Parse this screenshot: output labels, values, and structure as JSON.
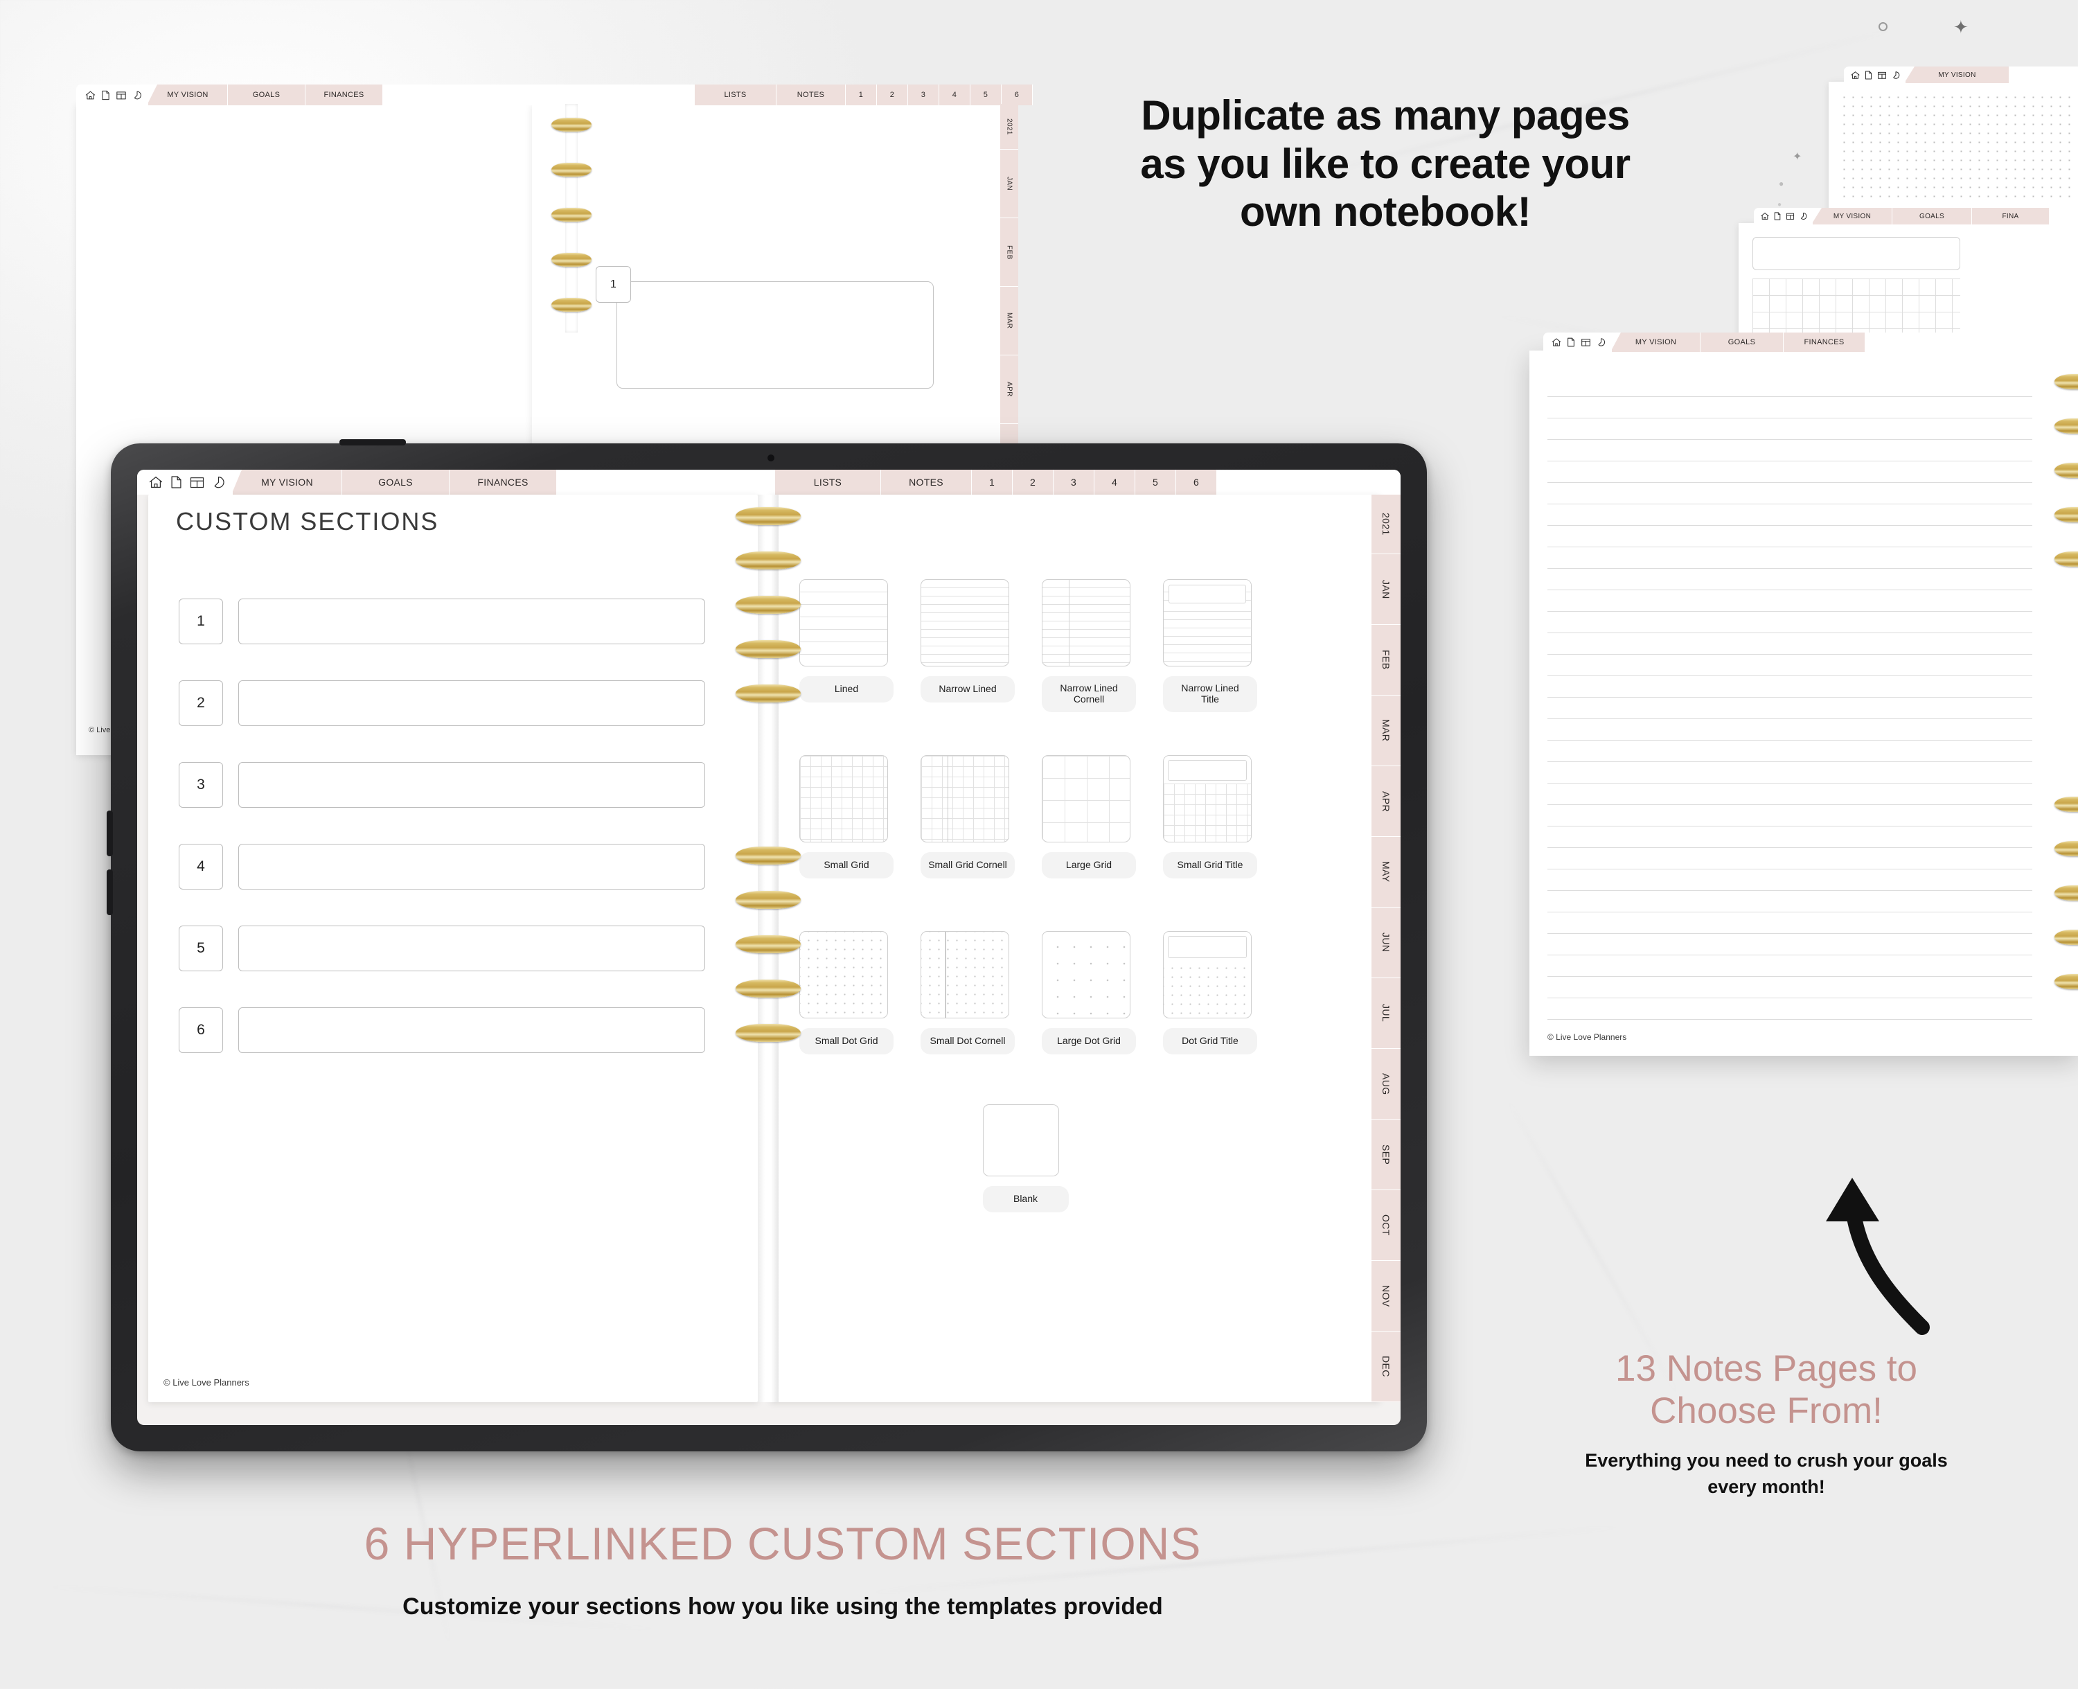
{
  "brand": {
    "accent": "#c4938f",
    "tab_pink": "#eedfdc",
    "copyright": "© Live Love Planners"
  },
  "annotations": {
    "top_right_headline": "Duplicate as many pages\nas you like to create your\nown notebook!",
    "top_right_line1": "Duplicate as many pages",
    "top_right_line2": "as you like to create your",
    "top_right_line3": "own notebook!",
    "bottom_right_headline_line1": "13 Notes Pages to",
    "bottom_right_headline_line2": "Choose From!",
    "bottom_right_sub_line1": "Everything you need to crush your goals",
    "bottom_right_sub_line2": "every month!",
    "bottom_center_headline": "6 HYPERLINKED CUSTOM SECTIONS",
    "bottom_center_sub": "Customize your sections how you like using the templates provided"
  },
  "toolbar": {
    "icons": [
      {
        "name": "home-icon",
        "label": "Home"
      },
      {
        "name": "page-icon",
        "label": "Page"
      },
      {
        "name": "layout-icon",
        "label": "Layout"
      },
      {
        "name": "sticker-icon",
        "label": "Stickers"
      }
    ],
    "left_tabs": [
      "MY VISION",
      "GOALS",
      "FINANCES"
    ],
    "right_tabs": [
      "LISTS",
      "NOTES"
    ],
    "number_tabs": [
      "1",
      "2",
      "3",
      "4",
      "5",
      "6"
    ]
  },
  "month_rail": {
    "year": "2021",
    "months": [
      "JAN",
      "FEB",
      "MAR",
      "APR",
      "MAY",
      "JUN",
      "JUL",
      "AUG",
      "SEP",
      "OCT",
      "NOV",
      "DEC"
    ]
  },
  "page": {
    "title": "CUSTOM SECTIONS",
    "sections": [
      {
        "number": "1",
        "value": ""
      },
      {
        "number": "2",
        "value": ""
      },
      {
        "number": "3",
        "value": ""
      },
      {
        "number": "4",
        "value": ""
      },
      {
        "number": "5",
        "value": ""
      },
      {
        "number": "6",
        "value": ""
      }
    ],
    "templates": [
      {
        "label": "Lined",
        "style": "lined"
      },
      {
        "label": "Narrow Lined",
        "style": "narrow-lined"
      },
      {
        "label": "Narrow Lined\nCornell",
        "style": "narrow-lined-cornell"
      },
      {
        "label": "Narrow Lined\nTitle",
        "style": "narrow-lined-title"
      },
      {
        "label": "Small Grid",
        "style": "small-grid"
      },
      {
        "label": "Small Grid Cornell",
        "style": "small-grid-cornell"
      },
      {
        "label": "Large Grid",
        "style": "large-grid"
      },
      {
        "label": "Small Grid Title",
        "style": "small-grid-title"
      },
      {
        "label": "Small Dot Grid",
        "style": "small-dot"
      },
      {
        "label": "Small Dot Cornell",
        "style": "small-dot-cornell"
      },
      {
        "label": "Large Dot Grid",
        "style": "large-dot"
      },
      {
        "label": "Dot Grid Title",
        "style": "dot-title"
      },
      {
        "label": "Blank",
        "style": "blank"
      }
    ]
  },
  "background_planners": {
    "top_left": {
      "left_tabs": [
        "MY VISION",
        "GOALS",
        "FINANCES"
      ],
      "right_tabs": [
        "LISTS",
        "NOTES"
      ],
      "number_tabs": [
        "1",
        "2",
        "3",
        "4",
        "5",
        "6"
      ],
      "field_number": "1",
      "copyright": "© Live Love Planners"
    },
    "top_right": {
      "left_tabs": [
        "MY VISION"
      ]
    },
    "mid_right": {
      "left_tabs": [
        "MY VISION",
        "GOALS",
        "FINA"
      ]
    },
    "notes_mock": {
      "left_tabs": [
        "MY VISION",
        "GOALS",
        "FINANCES"
      ],
      "copyright": "© Live Love Planners"
    }
  }
}
